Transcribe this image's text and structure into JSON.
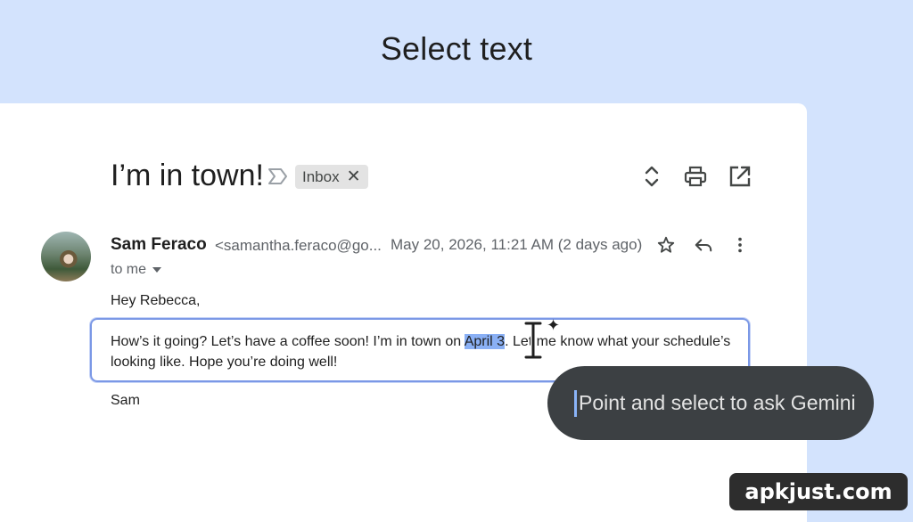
{
  "headline": "Select text",
  "email": {
    "subject": "I’m in town!",
    "label": "Inbox",
    "label_remove": "✕",
    "sender_name": "Sam Feraco",
    "sender_email": "<samantha.feraco@go...",
    "date": "May 20, 2026, 11:21 AM (2 days ago)",
    "to_me": "to me",
    "greeting": "Hey Rebecca,",
    "body_before": "How’s it going? Let’s have a coffee soon! I’m in town on ",
    "body_selected": "April 3",
    "body_after": ". Let me know what your schedule’s looking like. Hope you’re doing well!",
    "signature": "Sam"
  },
  "icons": {
    "important": "important-marker-icon",
    "expand": "unfold-icon",
    "print": "print-icon",
    "open_new": "open-in-new-window-icon",
    "star": "star-icon",
    "reply": "reply-icon",
    "more": "more-vert-icon",
    "dropdown": "caret-down-icon",
    "cursor": "text-cursor-icon",
    "sparkle": "gemini-sparkle-icon"
  },
  "gemini_prompt": {
    "placeholder": "Point and select to ask Gemini"
  },
  "watermark": "apkjust.com",
  "colors": {
    "background": "#d3e3fd",
    "selection": "#8ab0f5",
    "box_border": "#7b98e6",
    "pill": "#3c4043"
  }
}
